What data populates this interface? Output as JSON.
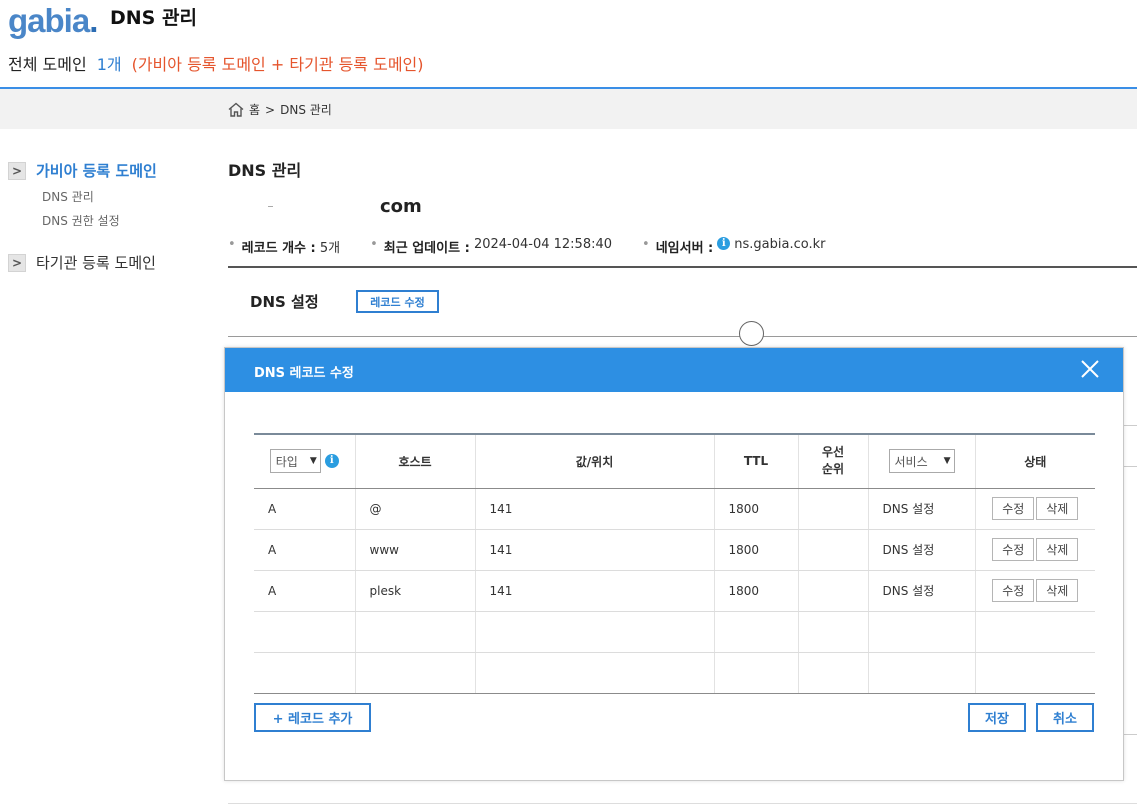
{
  "header": {
    "logo_text": "gabia",
    "logo_dot": ".",
    "title": "DNS 관리",
    "summary_label": "전체 도메인",
    "summary_count": "1개",
    "summary_desc": "(가비아 등록 도메인 + 타기관 등록 도메인)"
  },
  "breadcrumb": {
    "home": "홈",
    "separator": ">",
    "current": "DNS 관리"
  },
  "sidebar": {
    "groups": [
      {
        "label": "가비아 등록 도메인",
        "active": true,
        "subitems": [
          "DNS 관리",
          "DNS 권한 설정"
        ]
      },
      {
        "label": "타기관 등록 도메인",
        "active": false,
        "subitems": []
      }
    ]
  },
  "main": {
    "title": "DNS 관리",
    "domain": "com",
    "info": {
      "records_label": "레코드 개수 :",
      "records_value": "5개",
      "updated_label": "최근 업데이트 :",
      "updated_value": "2024-04-04 12:58:40",
      "ns_label": "네임서버 :",
      "ns_value": "ns.gabia.co.kr"
    },
    "dns_settings_title": "DNS 설정",
    "edit_records_label": "레코드 수정"
  },
  "modal": {
    "title": "DNS 레코드 수정",
    "columns": {
      "type_select": "타입",
      "host": "호스트",
      "value": "값/위치",
      "ttl": "TTL",
      "priority_1": "우선",
      "priority_2": "순위",
      "service_select": "서비스",
      "status": "상태"
    },
    "rows": [
      {
        "type": "A",
        "host": "@",
        "value": "141",
        "ttl": "1800",
        "priority": "",
        "service": "DNS 설정",
        "edit": "수정",
        "delete": "삭제"
      },
      {
        "type": "A",
        "host": "www",
        "value": "141",
        "ttl": "1800",
        "priority": "",
        "service": "DNS 설정",
        "edit": "수정",
        "delete": "삭제"
      },
      {
        "type": "A",
        "host": "plesk",
        "value": "141",
        "ttl": "1800",
        "priority": "",
        "service": "DNS 설정",
        "edit": "수정",
        "delete": "삭제"
      }
    ],
    "add_record_label": "+ 레코드 추가",
    "save_label": "저장",
    "cancel_label": "취소"
  },
  "icons": {
    "info": "info-icon",
    "home": "home-icon",
    "close": "close-icon",
    "chevron": "chevron-right-icon"
  },
  "colors": {
    "accent": "#2f7fd1",
    "modal_header": "#2d8fe3",
    "summary_desc": "#e5552d",
    "info_icon": "#2a9de0"
  }
}
